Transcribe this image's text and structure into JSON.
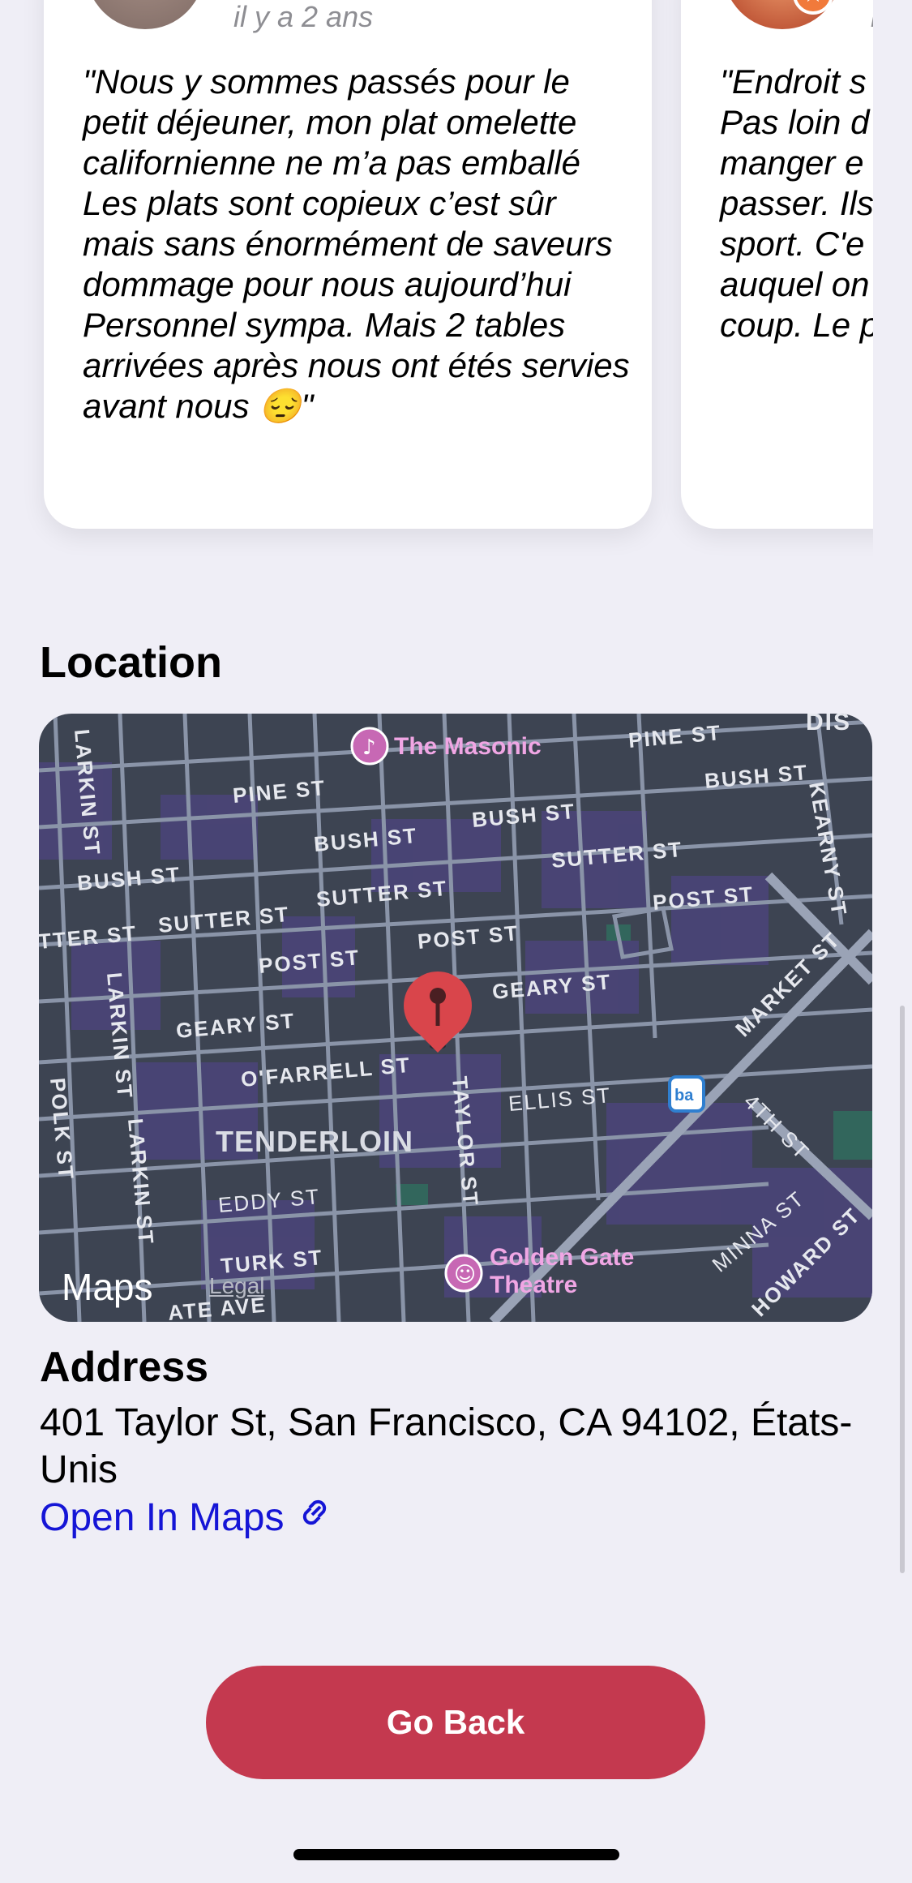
{
  "reviews": [
    {
      "time": "il y a 2 ans",
      "text": "\"Nous y sommes passés pour le petit déjeuner, mon plat omelette californienne ne m’a pas emballé\nLes plats sont copieux c’est sûr mais sans énormément de saveurs dommage pour nous aujourd’hui\nPersonnel sympa. Mais 2 tables arrivées après nous ont étés servies avant nous 😔\""
    },
    {
      "time": "i",
      "text": "\"Endroit s\nPas loin d\nmanger e\npasser. Ils\nsport. C'e\nauquel on\ncoup. Le p"
    }
  ],
  "location": {
    "title": "Location",
    "map": {
      "pois": [
        "The Masonic",
        "Golden Gate\nTheatre"
      ],
      "neighborhood": "TENDERLOIN",
      "streets": [
        "PINE ST",
        "PINE ST",
        "BUSH ST",
        "BUSH ST",
        "BUSH ST",
        "BUSH ST",
        "SUTTER ST",
        "SUTTER ST",
        "SUTTER ST",
        "TTER ST",
        "POST ST",
        "POST ST",
        "POST ST",
        "GEARY ST",
        "GEARY ST",
        "O'FARRELL ST",
        "ELLIS ST",
        "EDDY ST",
        "TURK ST",
        "ATE AVE",
        "TAYLOR ST",
        "LARKIN ST",
        "LARKIN ST",
        "LARKIN ST",
        "POLK ST",
        "KEARNY ST",
        "MARKET ST",
        "4TH ST",
        "MINNA ST",
        "HOWARD ST",
        "DIS"
      ],
      "attribution": "Maps",
      "legal": "Legal"
    }
  },
  "address": {
    "title": "Address",
    "text": "401 Taylor St, San Francisco, CA 94102, États-Unis",
    "open_in_maps": "Open In Maps"
  },
  "go_back": "Go Back",
  "colors": {
    "accent": "#c4394f",
    "link": "#1515d6",
    "background": "#efeef6"
  }
}
